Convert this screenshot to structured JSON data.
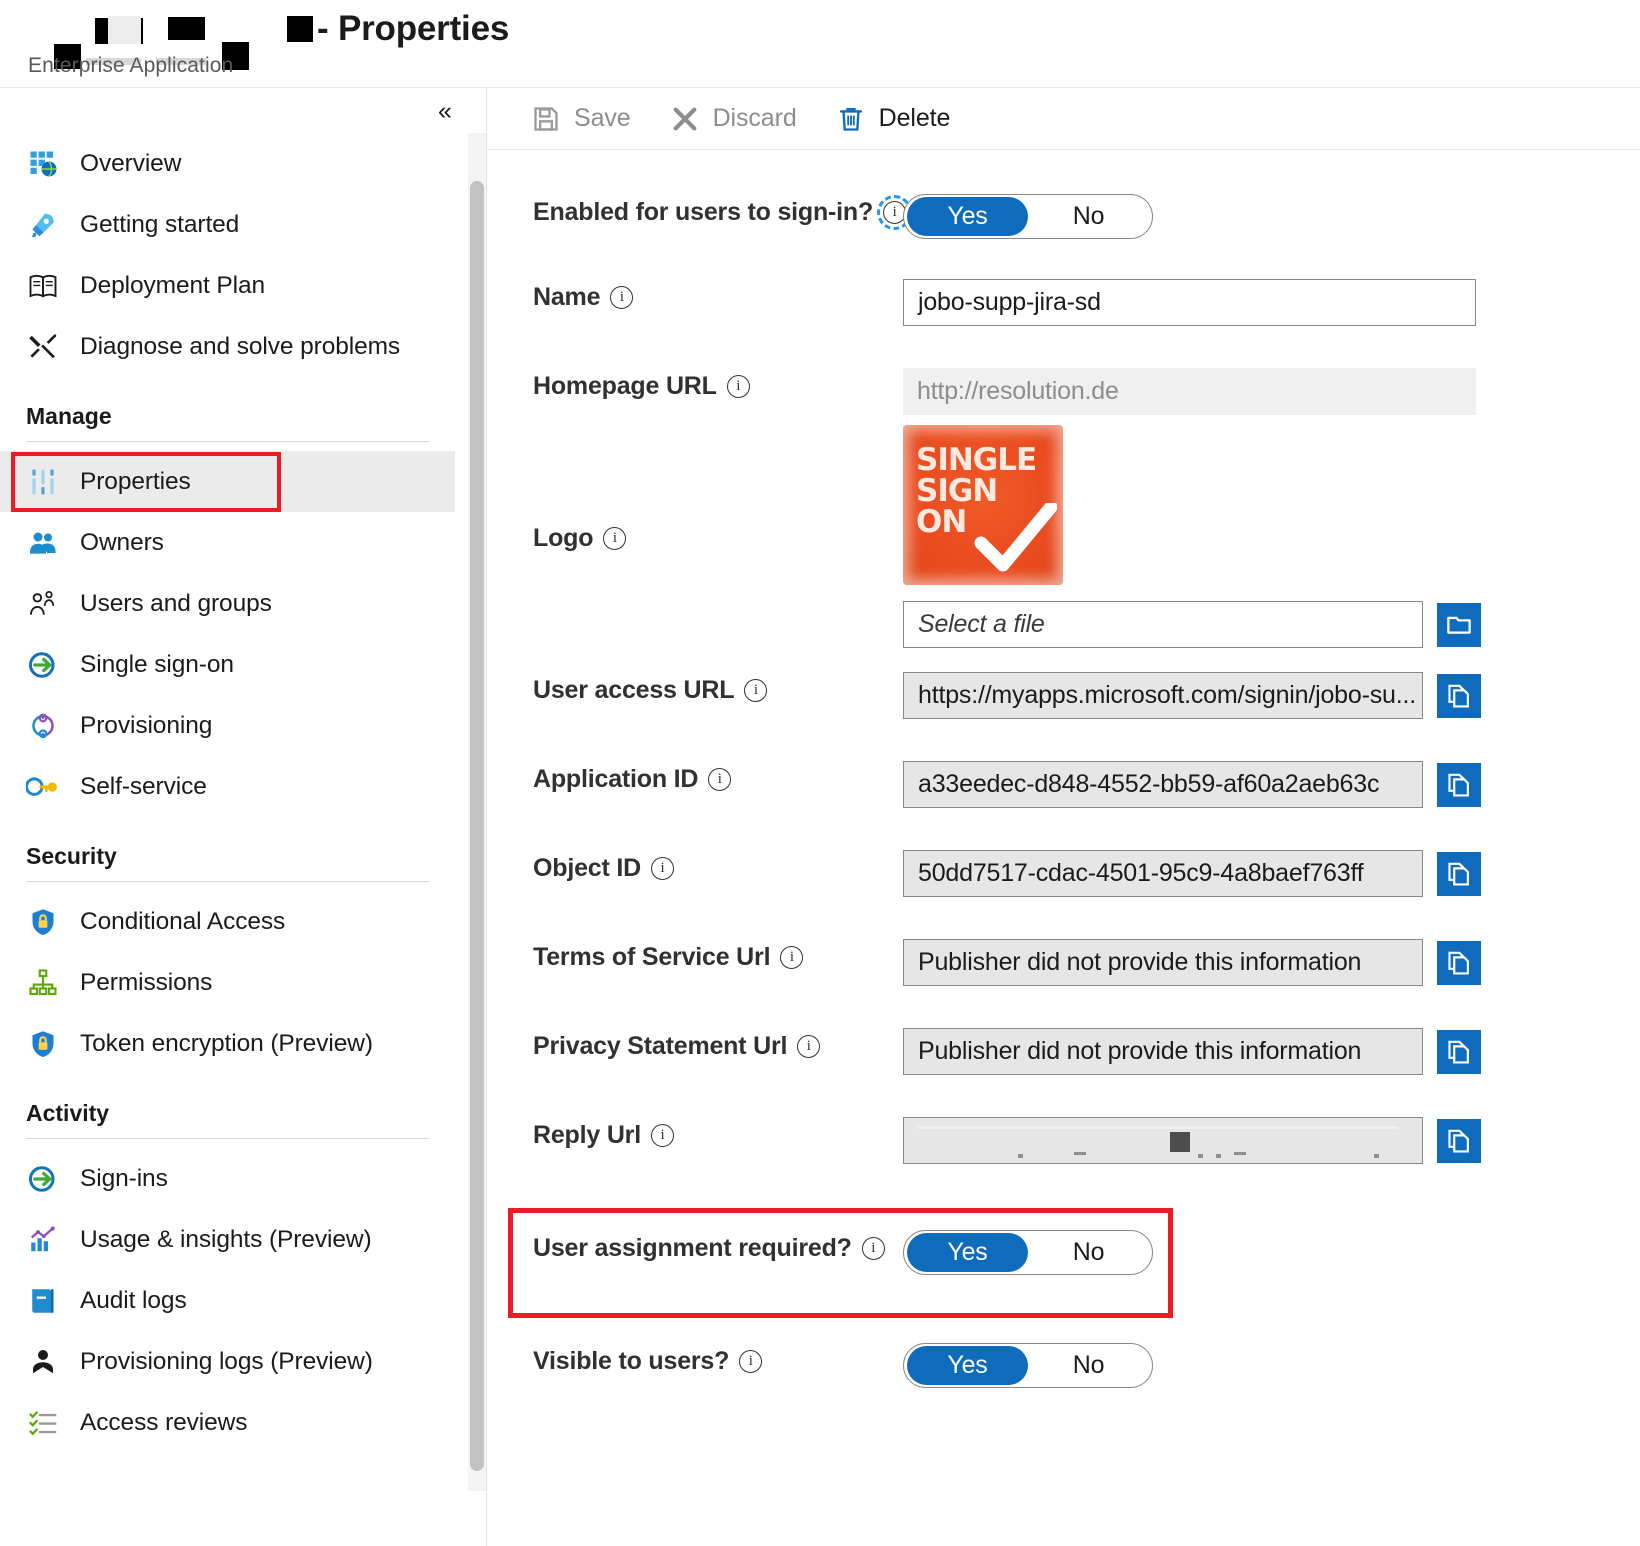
{
  "header": {
    "breadcrumb_label": "Enterprise Application",
    "page_title": "- Properties",
    "title_redacted": true
  },
  "sidebar": {
    "collapse_icon": "chevron-double-left-icon",
    "items": [
      {
        "label": "Overview",
        "icon": "grid-globe-icon",
        "selected": false
      },
      {
        "label": "Getting started",
        "icon": "rocket-icon",
        "selected": false
      },
      {
        "label": "Deployment Plan",
        "icon": "book-icon",
        "selected": false
      },
      {
        "label": "Diagnose and solve problems",
        "icon": "wrench-screwdriver-icon",
        "selected": false
      }
    ],
    "groups": [
      {
        "title": "Manage",
        "items": [
          {
            "label": "Properties",
            "icon": "sliders-icon",
            "selected": true,
            "highlighted": true
          },
          {
            "label": "Owners",
            "icon": "people-icon",
            "selected": false
          },
          {
            "label": "Users and groups",
            "icon": "user-group-outline-icon",
            "selected": false
          },
          {
            "label": "Single sign-on",
            "icon": "sign-in-arrow-icon",
            "selected": false
          },
          {
            "label": "Provisioning",
            "icon": "provisioning-cycle-icon",
            "selected": false
          },
          {
            "label": "Self-service",
            "icon": "key-icon",
            "selected": false
          }
        ]
      },
      {
        "title": "Security",
        "items": [
          {
            "label": "Conditional Access",
            "icon": "shield-lock-icon",
            "selected": false
          },
          {
            "label": "Permissions",
            "icon": "org-tree-icon",
            "selected": false
          },
          {
            "label": "Token encryption (Preview)",
            "icon": "shield-lock-icon",
            "selected": false
          }
        ]
      },
      {
        "title": "Activity",
        "items": [
          {
            "label": "Sign-ins",
            "icon": "sign-in-arrow-icon",
            "selected": false
          },
          {
            "label": "Usage & insights (Preview)",
            "icon": "bar-chart-icon",
            "selected": false
          },
          {
            "label": "Audit logs",
            "icon": "book-blue-icon",
            "selected": false
          },
          {
            "label": "Provisioning logs (Preview)",
            "icon": "person-log-icon",
            "selected": false
          },
          {
            "label": "Access reviews",
            "icon": "checklist-icon",
            "selected": false
          }
        ]
      }
    ]
  },
  "toolbar": {
    "save_label": "Save",
    "save_enabled": false,
    "discard_label": "Discard",
    "discard_enabled": false,
    "delete_label": "Delete",
    "delete_enabled": true,
    "save_icon": "floppy-disk-icon",
    "discard_icon": "x-close-icon",
    "delete_icon": "trash-icon"
  },
  "form": {
    "enabled_signin": {
      "label": "Enabled for users to sign-in?",
      "yes": "Yes",
      "no": "No",
      "selected": "Yes",
      "info_focused": true
    },
    "name": {
      "label": "Name",
      "value": "jobo-supp-jira-sd"
    },
    "homepage_url": {
      "label": "Homepage URL",
      "value": "http://resolution.de"
    },
    "logo": {
      "label": "Logo",
      "image_text_lines": [
        "SINGLE",
        "SIGN",
        "ON"
      ],
      "file_placeholder": "Select a file",
      "browse_icon": "folder-icon"
    },
    "user_access_url": {
      "label": "User access URL",
      "value": "https://myapps.microsoft.com/signin/jobo-su...",
      "copy_icon": "copy-icon"
    },
    "application_id": {
      "label": "Application ID",
      "value": "a33eedec-d848-4552-bb59-af60a2aeb63c",
      "copy_icon": "copy-icon"
    },
    "object_id": {
      "label": "Object ID",
      "value": "50dd7517-cdac-4501-95c9-4a8baef763ff",
      "copy_icon": "copy-icon"
    },
    "terms_of_service_url": {
      "label": "Terms of Service Url",
      "value": "Publisher did not provide this information",
      "copy_icon": "copy-icon"
    },
    "privacy_statement_url": {
      "label": "Privacy Statement Url",
      "value": "Publisher did not provide this information",
      "copy_icon": "copy-icon"
    },
    "reply_url": {
      "label": "Reply Url",
      "value": "",
      "redacted": true,
      "copy_icon": "copy-icon"
    },
    "user_assignment_required": {
      "label": "User assignment required?",
      "yes": "Yes",
      "no": "No",
      "selected": "Yes",
      "highlighted": true
    },
    "visible_to_users": {
      "label": "Visible to users?",
      "yes": "Yes",
      "no": "No",
      "selected": "Yes"
    }
  },
  "colors": {
    "accent_blue": "#0f6cbd",
    "highlight_red": "#ed1c24",
    "readonly_bg": "#e6e6e6",
    "selected_nav_bg": "#ebebeb"
  }
}
